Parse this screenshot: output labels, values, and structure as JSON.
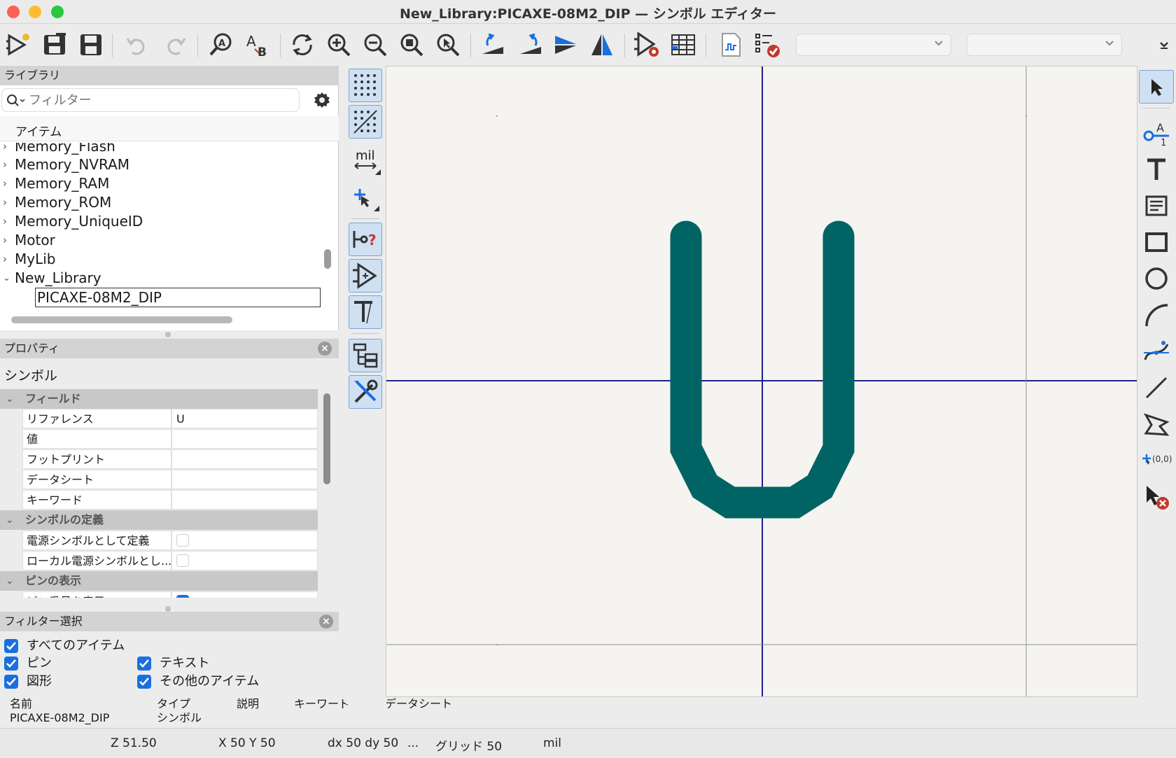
{
  "window": {
    "title": "New_Library:PICAXE-08M2_DIP — シンボル エディター",
    "traffic": {
      "close": "#ff5f57",
      "minimize": "#febc2e",
      "maximize": "#28c840"
    }
  },
  "library": {
    "header": "ライブラリ",
    "search_placeholder": "フィルター",
    "column_header": "アイテム",
    "items": [
      {
        "label": "Memory_Flash",
        "expanded": false
      },
      {
        "label": "Memory_NVRAM",
        "expanded": false
      },
      {
        "label": "Memory_RAM",
        "expanded": false
      },
      {
        "label": "Memory_ROM",
        "expanded": false
      },
      {
        "label": "Memory_UniqueID",
        "expanded": false
      },
      {
        "label": "Motor",
        "expanded": false
      },
      {
        "label": "MyLib",
        "expanded": false
      },
      {
        "label": "New_Library",
        "expanded": true
      }
    ],
    "child_item": "PICAXE-08M2_DIP"
  },
  "properties": {
    "header": "プロパティ",
    "object_type": "シンボル",
    "fields_category": "フィールド",
    "rows": [
      {
        "key": "リファレンス",
        "value": "U"
      },
      {
        "key": "値",
        "value": ""
      },
      {
        "key": "フットプリント",
        "value": ""
      },
      {
        "key": "データシート",
        "value": ""
      },
      {
        "key": "キーワード",
        "value": ""
      }
    ],
    "definition_category": "シンボルの定義",
    "definition_rows": [
      {
        "key": "電源シンボルとして定義",
        "checked": false
      },
      {
        "key": "ローカル電源シンボルとし...",
        "checked": false
      }
    ],
    "pin_category": "ピンの表示",
    "pin_rows": [
      {
        "key": "ピン番号を表示",
        "checked": true
      }
    ]
  },
  "filter": {
    "header": "フィルター選択",
    "all_items": "すべてのアイテム",
    "pins": "ピン",
    "graphics": "図形",
    "text": "テキスト",
    "other": "その他のアイテム"
  },
  "info_bar": {
    "name_label": "名前",
    "name_value": "PICAXE-08M2_DIP",
    "type_label": "タイプ",
    "type_value": "シンボル",
    "desc_label": "説明",
    "keyword_label": "キーワード",
    "datasheet_label": "データシート"
  },
  "status": {
    "zoom": "Z 51.50",
    "xy": "X 50  Y 50",
    "dxdy": "dx 50  dy 50",
    "ellipsis": "...",
    "grid": "グリッド 50",
    "units": "mil"
  },
  "left_toolbar": {
    "units_label": "mil"
  },
  "right_toolbar": {
    "origin_label": "(0,0)"
  },
  "canvas": {
    "glyph_color": "#006465",
    "axis_color": "#1d1f8c",
    "background": "#f5f4f1"
  }
}
